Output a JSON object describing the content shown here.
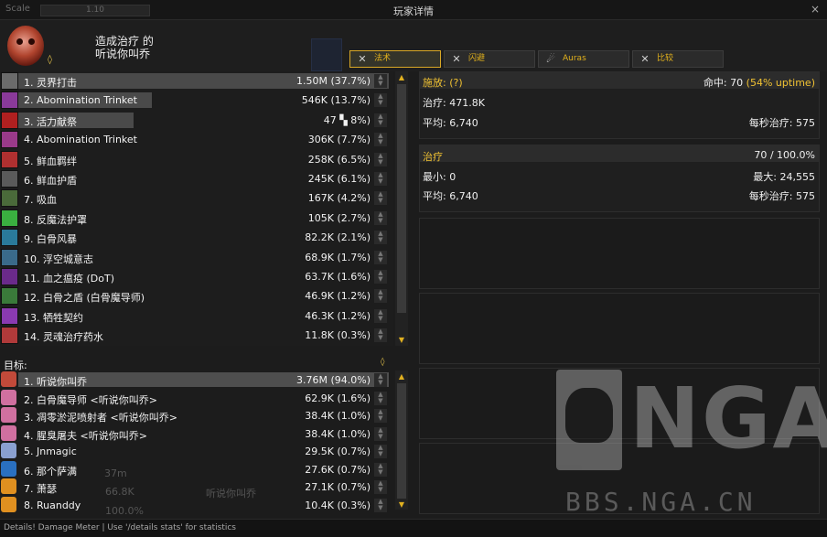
{
  "topbar": {
    "scale_label": "Scale",
    "scale_value": "1.10",
    "title": "玩家详情",
    "close_glyph": "×"
  },
  "header": {
    "line1": "造成治疗 的",
    "line2": "听说你叫乔"
  },
  "tabs": [
    {
      "label": "法术",
      "icon": "spell-icon",
      "active": true
    },
    {
      "label": "闪避",
      "icon": "dodge-icon",
      "active": false
    },
    {
      "label": "Auras",
      "icon": "auras-icon",
      "active": false
    },
    {
      "label": "比较",
      "icon": "compare-icon",
      "active": false
    }
  ],
  "spells": [
    {
      "name": "1. 灵界打击",
      "value": "1.50M (37.7%)",
      "fill": 1.0,
      "color": "#6b6b6b",
      "highlight": true
    },
    {
      "name": "2. Abomination Trinket",
      "value": "546K (13.7%)",
      "fill": 0.36,
      "color": "#8a3a9a",
      "highlight": true
    },
    {
      "name": "3. 活力献祭",
      "value": "47",
      "value2": "8%)",
      "fill": 0.31,
      "color": "#b02020",
      "highlight": true
    },
    {
      "name": "4. Abomination Trinket",
      "value": "306K (7.7%)",
      "fill": 0,
      "color": "#9a3a8a"
    },
    {
      "name": "5. 鲜血羁绊",
      "value": "258K (6.5%)",
      "fill": 0,
      "color": "#b03030"
    },
    {
      "name": "6. 鲜血护盾",
      "value": "245K (6.1%)",
      "fill": 0,
      "color": "#5a5a5a"
    },
    {
      "name": "7. 吸血",
      "value": "167K (4.2%)",
      "fill": 0,
      "color": "#4a6a3a"
    },
    {
      "name": "8. 反魔法护罩",
      "value": "105K (2.7%)",
      "fill": 0,
      "color": "#3ab040"
    },
    {
      "name": "9. 白骨风暴",
      "value": "82.2K (2.1%)",
      "fill": 0,
      "color": "#2a7a9a"
    },
    {
      "name": "10. 浮空城意志",
      "value": "68.9K (1.7%)",
      "fill": 0,
      "color": "#3a6a8a"
    },
    {
      "name": "11. 血之瘟疫 (DoT)",
      "value": "63.7K (1.6%)",
      "fill": 0,
      "color": "#6a2a8a"
    },
    {
      "name": "12. 白骨之盾 (白骨魔导师)",
      "value": "46.9K (1.2%)",
      "fill": 0,
      "color": "#3a7a3a"
    },
    {
      "name": "13. 牺牲契约",
      "value": "46.3K (1.2%)",
      "fill": 0,
      "color": "#8a3ab0"
    },
    {
      "name": "14. 灵魂治疗药水",
      "value": "11.8K (0.3%)",
      "fill": 0,
      "color": "#b03a3a"
    }
  ],
  "targets": {
    "label": "目标:",
    "rows": [
      {
        "name": "1. 听说你叫乔",
        "value": "3.76M (94.0%)",
        "fill": 1.0,
        "color": "#c24a3a"
      },
      {
        "name": "2. 白骨魔导师 <听说你叫乔>",
        "value": "62.9K (1.6%)",
        "fill": 0,
        "color": "#d070a0"
      },
      {
        "name": "3. 凋零淤泥喷射者 <听说你叫乔>",
        "value": "38.4K (1.0%)",
        "fill": 0,
        "color": "#d070a0"
      },
      {
        "name": "4. 腥臭屠夫 <听说你叫乔>",
        "value": "38.4K (1.0%)",
        "fill": 0,
        "color": "#d070a0"
      },
      {
        "name": "5. Jnmagic",
        "value": "29.5K (0.7%)",
        "fill": 0,
        "color": "#8aa0d0"
      },
      {
        "name": "6. 那个萨满",
        "value": "27.6K (0.7%)",
        "fill": 0,
        "color": "#2a70c0"
      },
      {
        "name": "7. 萧瑟",
        "value": "27.1K (0.7%)",
        "fill": 0,
        "color": "#e09020"
      },
      {
        "name": "8. Ruanddy",
        "value": "10.4K (0.3%)",
        "fill": 0,
        "color": "#e09020"
      }
    ]
  },
  "cast_box": {
    "cast_label": "施放:",
    "cast_value": "(?)",
    "hit_label": "命中:",
    "hit_value": "70",
    "uptime": "(54% uptime)",
    "heal_label": "治疗:",
    "heal_value": "471.8K",
    "avg_label": "平均:",
    "avg_value": "6,740",
    "hps_label": "每秒治疗:",
    "hps_value": "575"
  },
  "heal_box": {
    "title": "治疗",
    "count": "70 / 100.0%",
    "min_label": "最小:",
    "min_value": "0",
    "max_label": "最大:",
    "max_value": "24,555",
    "avg_label": "平均:",
    "avg_value": "6,740",
    "hps_label": "每秒治疗:",
    "hps_value": "575"
  },
  "watermark": {
    "logo_text": "NGA",
    "url": "BBS.NGA.CN"
  },
  "ghost_text": {
    "a": "66.8K",
    "b": "听说你叫乔",
    "c": "100.0%",
    "d": "37m"
  },
  "status": {
    "text": "Details! Damage Meter | Use '/details stats' for statistics"
  },
  "colors": {
    "accent_gold": "#f1c232",
    "bar": "#4a4a4a",
    "tab_border_active": "#d9a826"
  }
}
